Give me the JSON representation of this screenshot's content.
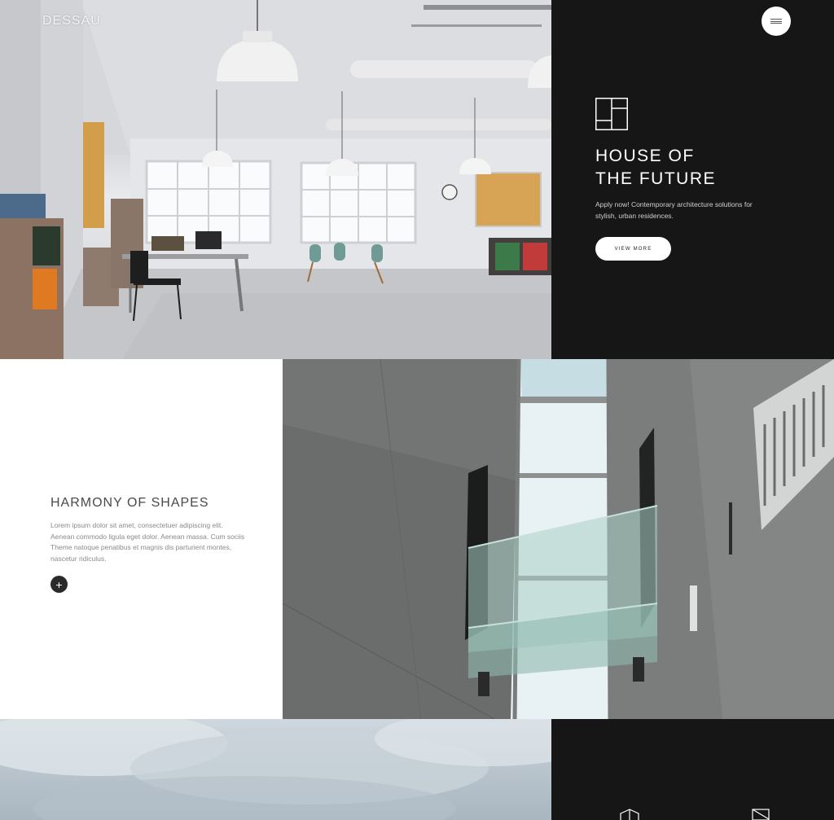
{
  "header": {
    "logo": "DESSAU",
    "menu_icon": "hamburger-menu-icon"
  },
  "hero": {
    "icon": "floor-plan-icon",
    "title_line1": "HOUSE OF",
    "title_line2": "THE FUTURE",
    "text": "Apply now! Contemporary architecture solutions for stylish, urban residences.",
    "button_label": "VIEW MORE",
    "image": "office-interior-photo"
  },
  "feature": {
    "title": "HARMONY OF SHAPES",
    "body": "Lorem ipsum dolor sit amet, consectetuer adipiscing elit. Aenean commodo ligula eget dolor. Aenean massa. Cum sociis Theme natoque penatibus et magnis dis parturient montes, nascetur ridiculus.",
    "plus_icon": "plus-icon",
    "image": "concrete-glass-bridge-photo"
  },
  "bottom": {
    "image": "cloudy-sky-photo",
    "icons": [
      "cube-icon",
      "blueprint-icon"
    ]
  },
  "colors": {
    "dark_panel": "#161616",
    "button_bg": "#ffffff",
    "title_gray": "#4a4a4a",
    "body_gray": "#8a8a8a"
  }
}
